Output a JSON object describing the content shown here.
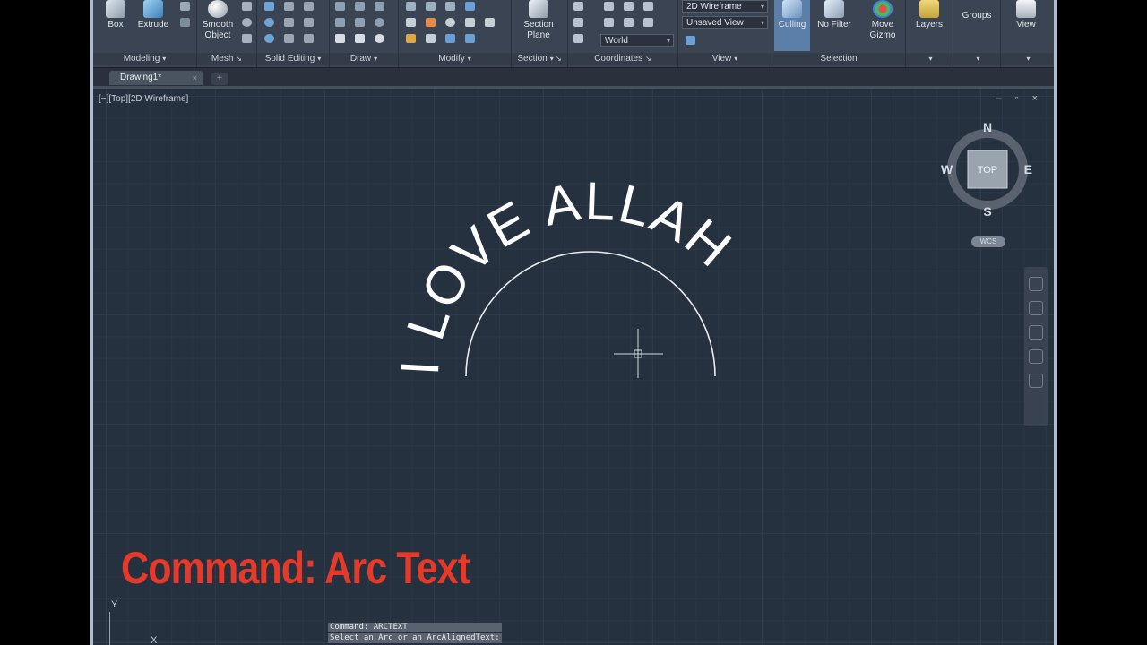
{
  "ribbon": {
    "modeling": {
      "title": "Modeling",
      "box": "Box",
      "extrude": "Extrude"
    },
    "mesh": {
      "title": "Mesh",
      "smooth_object_line1": "Smooth",
      "smooth_object_line2": "Object"
    },
    "solid_editing": {
      "title": "Solid Editing"
    },
    "draw": {
      "title": "Draw"
    },
    "modify": {
      "title": "Modify"
    },
    "section": {
      "title": "Section",
      "section_plane_line1": "Section",
      "section_plane_line2": "Plane"
    },
    "coordinates": {
      "title": "Coordinates",
      "ucs_combo": "World"
    },
    "view": {
      "title": "View",
      "visual_style": "2D Wireframe",
      "named_view": "Unsaved View"
    },
    "selection": {
      "title": "Selection",
      "culling": "Culling",
      "no_filter": "No Filter",
      "move_gizmo_line1": "Move",
      "move_gizmo_line2": "Gizmo"
    },
    "layers": "Layers",
    "groups": "Groups",
    "view_btn": "View"
  },
  "tabs": {
    "drawing": "Drawing1*",
    "close": "×",
    "new": "+"
  },
  "viewport": {
    "label": "[−][Top][2D Wireframe]",
    "controls": "– ▫ ×",
    "viewcube": {
      "face": "TOP",
      "n": "N",
      "s": "S",
      "e": "E",
      "w": "W"
    },
    "wcs": "WCS",
    "arc_text": "I LOVE ALLAH",
    "ucs_y": "Y",
    "ucs_x": "X"
  },
  "overlay_title": "Command: Arc Text",
  "command_history": [
    "Command: ARCTEXT",
    "Select an Arc or an ArcAlignedText:"
  ],
  "colors": {
    "accent_overlay": "#e53a2a",
    "canvas": "#263140",
    "ribbon": "#3b4452"
  }
}
